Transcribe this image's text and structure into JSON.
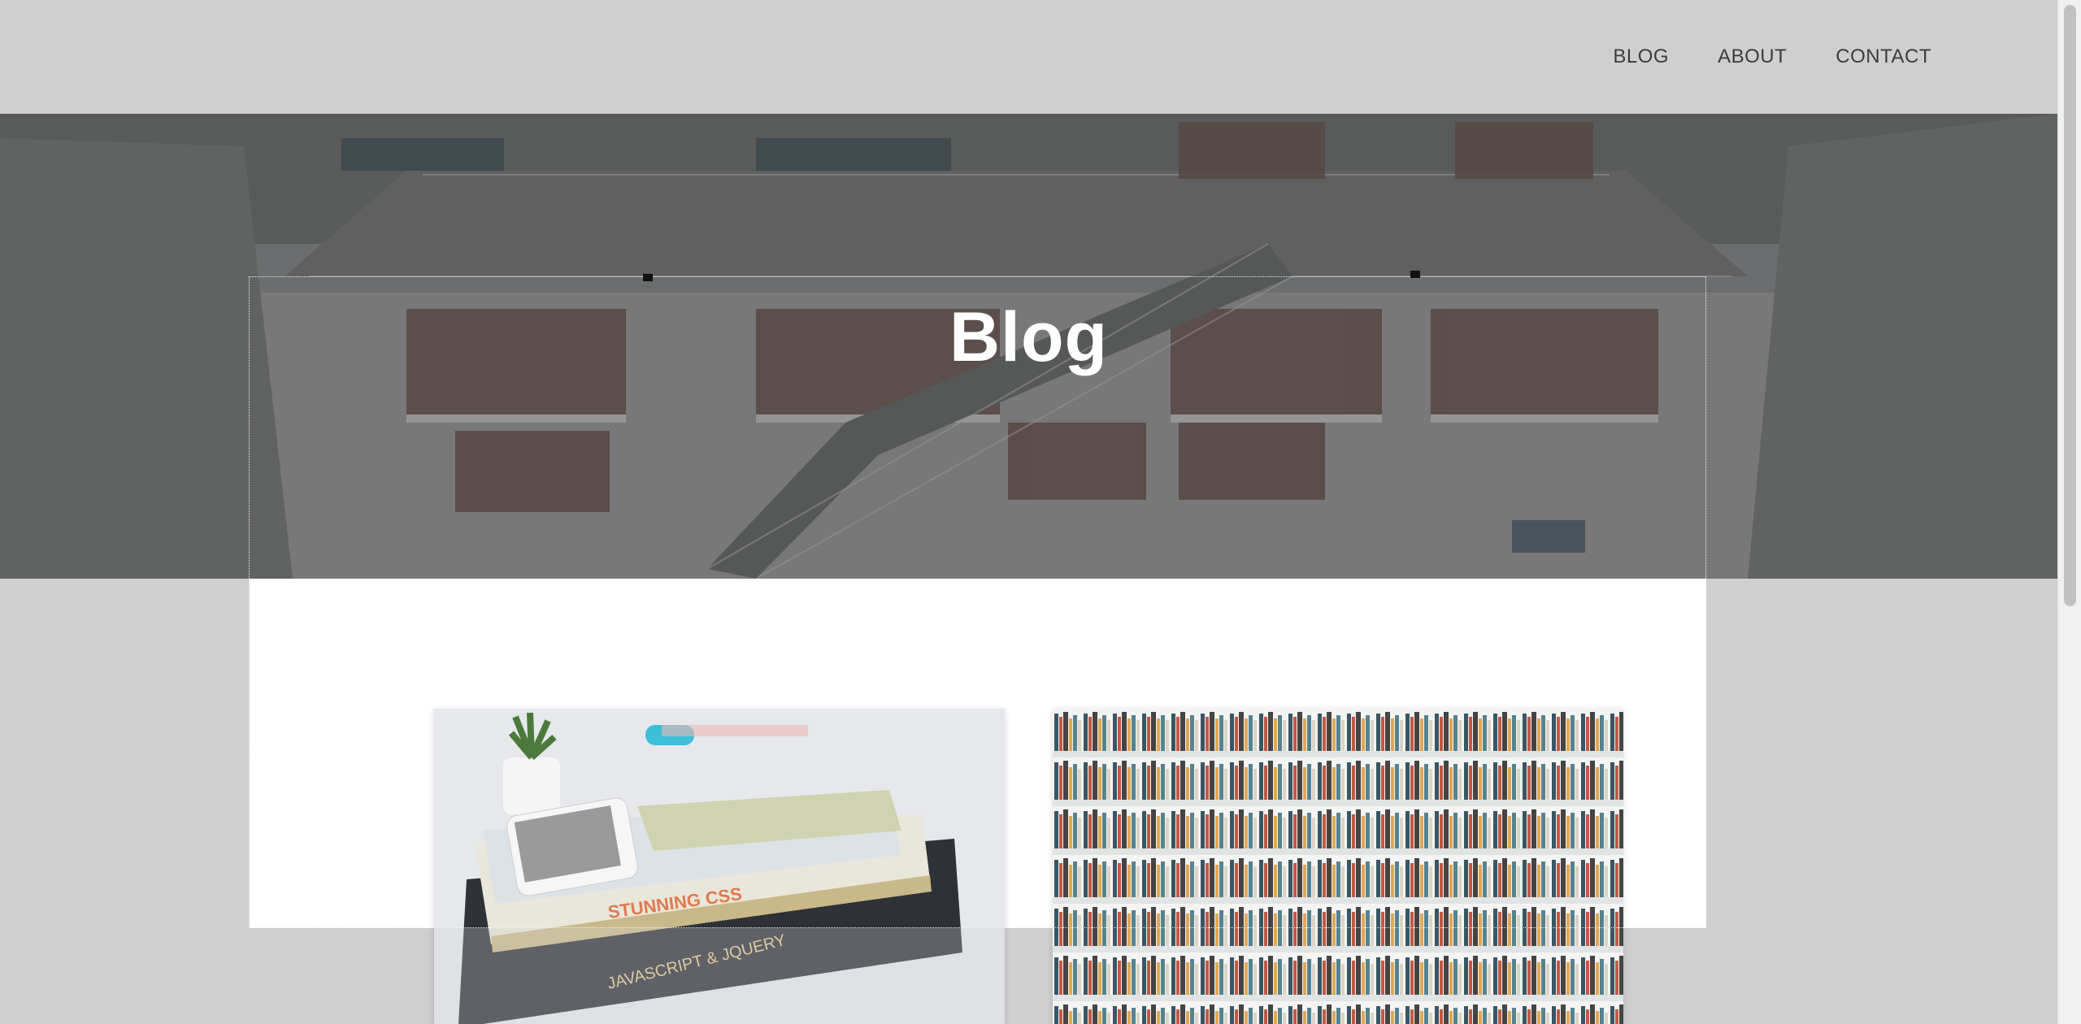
{
  "nav": {
    "items": [
      {
        "label": "BLOG"
      },
      {
        "label": "ABOUT"
      },
      {
        "label": "CONTACT"
      }
    ]
  },
  "hero": {
    "title": "Blog",
    "image": "library-atrium-photo"
  },
  "posts": [
    {
      "image": "css-books-and-phone-photo"
    },
    {
      "image": "bookshelf-photo"
    }
  ],
  "colors": {
    "background": "#cfcfcf",
    "nav_text": "#3c3c3c",
    "hero_title": "#ffffff",
    "panel": "#ffffff"
  }
}
